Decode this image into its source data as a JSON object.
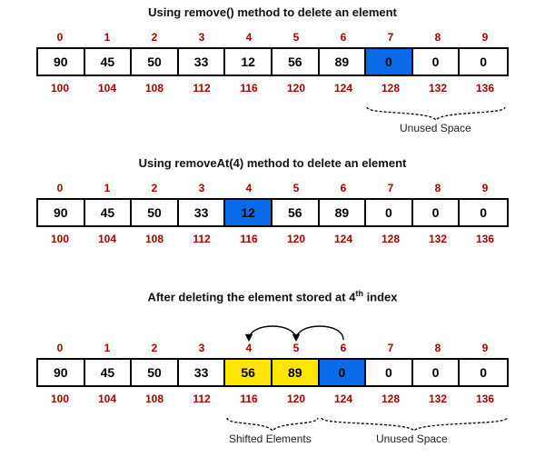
{
  "sections": [
    {
      "caption": "Using remove() method to delete an element",
      "indices": [
        "0",
        "1",
        "2",
        "3",
        "4",
        "5",
        "6",
        "7",
        "8",
        "9"
      ],
      "cells": [
        "90",
        "45",
        "50",
        "33",
        "12",
        "56",
        "89",
        "0",
        "0",
        "0"
      ],
      "addrs": [
        "100",
        "104",
        "108",
        "112",
        "116",
        "120",
        "124",
        "128",
        "132",
        "136"
      ],
      "highlight": {
        "7": "blue"
      },
      "unused": {
        "label": "Unused Space",
        "from": 7,
        "to": 9
      }
    },
    {
      "caption": "Using removeAt(4) method to delete an element",
      "indices": [
        "0",
        "1",
        "2",
        "3",
        "4",
        "5",
        "6",
        "7",
        "8",
        "9"
      ],
      "cells": [
        "90",
        "45",
        "50",
        "33",
        "12",
        "56",
        "89",
        "0",
        "0",
        "0"
      ],
      "addrs": [
        "100",
        "104",
        "108",
        "112",
        "116",
        "120",
        "124",
        "128",
        "132",
        "136"
      ],
      "highlight": {
        "4": "blue"
      }
    },
    {
      "caption_html": "After deleting the element stored at 4<sup>th</sup> index",
      "caption": "After deleting the element stored at 4th index",
      "indices": [
        "0",
        "1",
        "2",
        "3",
        "4",
        "5",
        "6",
        "7",
        "8",
        "9"
      ],
      "cells": [
        "90",
        "45",
        "50",
        "33",
        "56",
        "89",
        "0",
        "0",
        "0",
        "0"
      ],
      "addrs": [
        "100",
        "104",
        "108",
        "112",
        "116",
        "120",
        "124",
        "128",
        "132",
        "136"
      ],
      "highlight": {
        "4": "yellow",
        "5": "yellow",
        "6": "blue"
      },
      "shifted": {
        "label": "Shifted Elements",
        "from": 4,
        "to": 5
      },
      "unused": {
        "label": "Unused Space",
        "from": 6,
        "to": 9
      },
      "arrows": [
        {
          "from": 5,
          "to": 4
        },
        {
          "from": 6,
          "to": 5
        }
      ]
    }
  ]
}
